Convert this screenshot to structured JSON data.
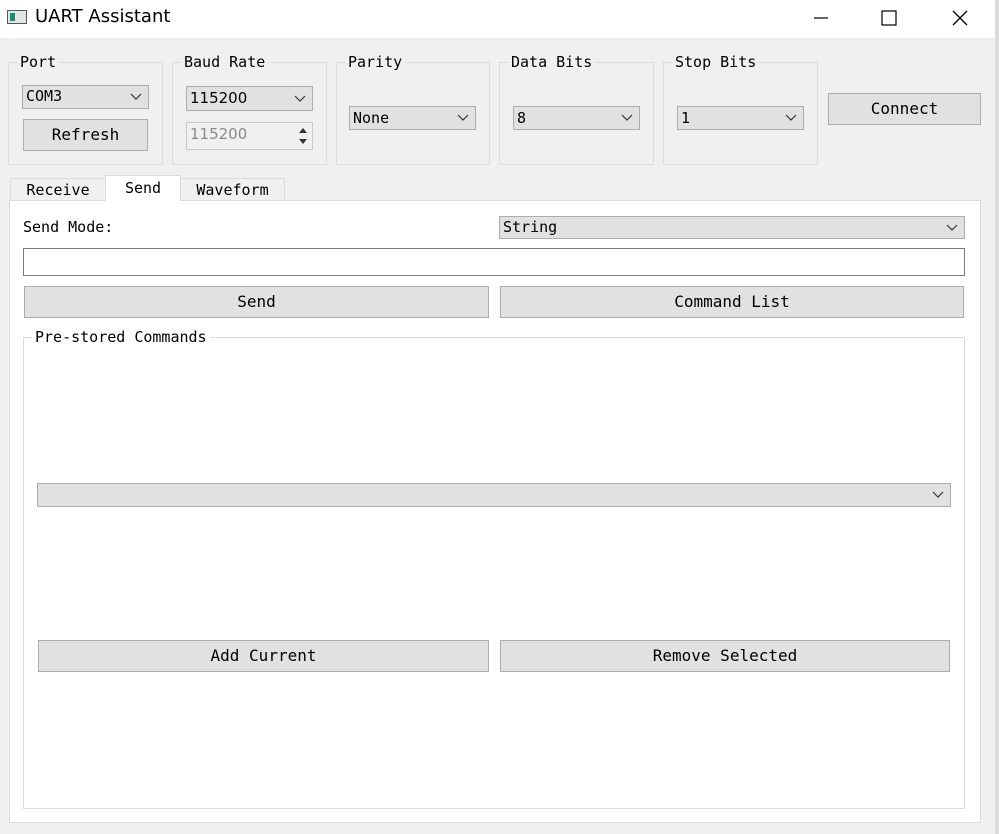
{
  "window": {
    "title": "UART Assistant"
  },
  "port": {
    "label": "Port",
    "selected": "COM3",
    "refresh_label": "Refresh"
  },
  "baud": {
    "label": "Baud Rate",
    "selected": "115200",
    "custom_value": "115200"
  },
  "parity": {
    "label": "Parity",
    "selected": "None"
  },
  "data_bits": {
    "label": "Data Bits",
    "selected": "8"
  },
  "stop_bits": {
    "label": "Stop Bits",
    "selected": "1"
  },
  "connect_label": "Connect",
  "tabs": [
    {
      "label": "Receive"
    },
    {
      "label": "Send"
    },
    {
      "label": "Waveform"
    }
  ],
  "send": {
    "mode_label": "Send Mode:",
    "mode_selected": "String",
    "input_value": "",
    "send_label": "Send",
    "command_list_label": "Command List"
  },
  "prestored": {
    "title": "Pre-stored Commands",
    "selected": "",
    "add_label": "Add Current",
    "remove_label": "Remove Selected"
  }
}
